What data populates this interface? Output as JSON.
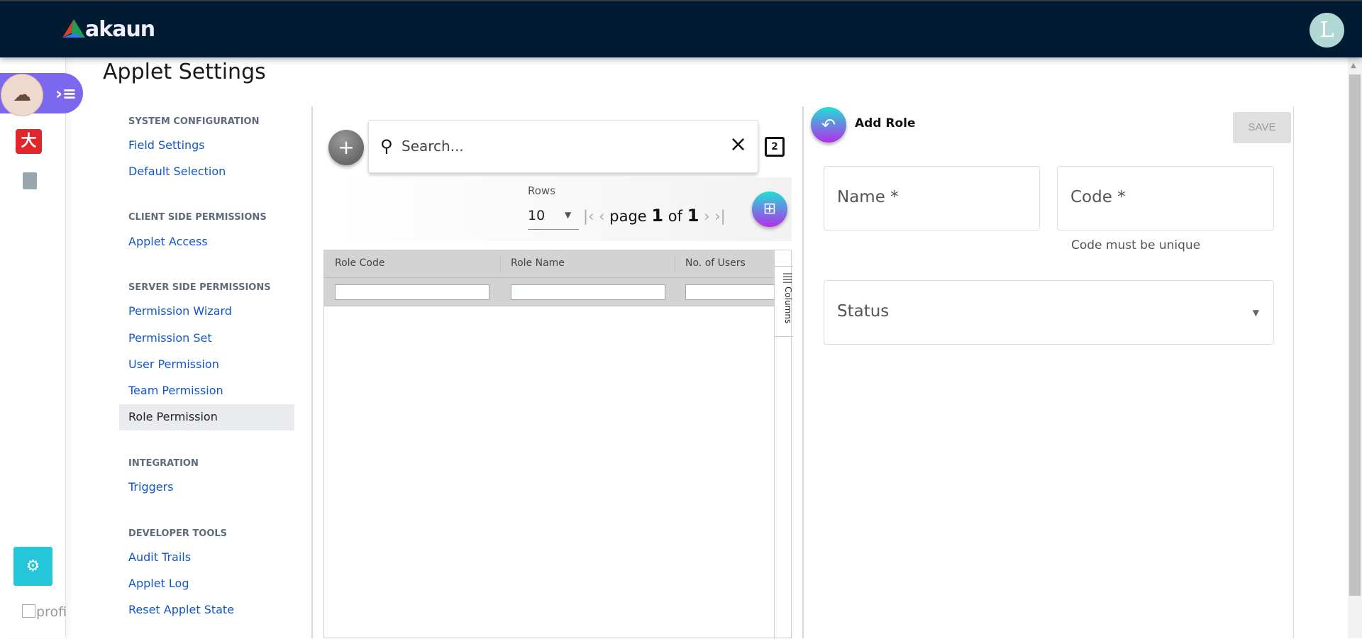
{
  "header": {
    "brand": "akaun",
    "avatar_letter": "L"
  },
  "rail": {
    "profile_label": "profi"
  },
  "page": {
    "title": "Applet Settings"
  },
  "nav": {
    "sections": [
      {
        "heading": "SYSTEM CONFIGURATION",
        "items": [
          "Field Settings",
          "Default Selection"
        ]
      },
      {
        "heading": "CLIENT SIDE PERMISSIONS",
        "items": [
          "Applet Access"
        ]
      },
      {
        "heading": "SERVER SIDE PERMISSIONS",
        "items": [
          "Permission Wizard",
          "Permission Set",
          "User Permission",
          "Team Permission",
          "Role Permission"
        ]
      },
      {
        "heading": "INTEGRATION",
        "items": [
          "Triggers"
        ]
      },
      {
        "heading": "DEVELOPER TOOLS",
        "items": [
          "Audit Trails",
          "Applet Log",
          "Reset Applet State"
        ]
      }
    ],
    "active": "Role Permission"
  },
  "list": {
    "search_placeholder": "Search...",
    "rows_label": "Rows",
    "rows_value": "10",
    "page_word": "page",
    "page_current": "1",
    "of_word": "of",
    "page_total": "1",
    "columns": [
      "Role Code",
      "Role Name",
      "No. of Users"
    ],
    "columns_panel": "Columns"
  },
  "form": {
    "title": "Add Role",
    "save_label": "SAVE",
    "name_label": "Name *",
    "code_label": "Code *",
    "code_hint": "Code must be unique",
    "status_label": "Status"
  },
  "colors": {
    "header": "#011b33",
    "accent_purple": "#7b68ee",
    "link": "#1155cc",
    "settings_button": "#26c6da"
  }
}
